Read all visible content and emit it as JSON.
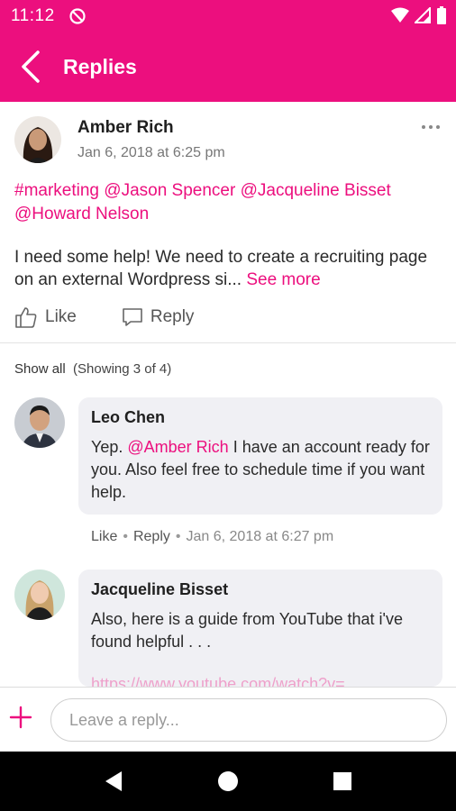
{
  "status_bar": {
    "time": "11:12"
  },
  "app_bar": {
    "title": "Replies"
  },
  "post": {
    "author": "Amber Rich",
    "timestamp": "Jan 6, 2018 at 6:25 pm",
    "tags": [
      "#marketing",
      "@Jason Spencer",
      "@Jacqueline Bisset",
      "@Howard Nelson"
    ],
    "body": "I need some help! We need to create a recruiting page on an external Wordpress si...",
    "see_more": "See more",
    "like_label": "Like",
    "reply_label": "Reply"
  },
  "replies_header": {
    "show_all": "Show all",
    "showing": "(Showing 3 of 4)"
  },
  "replies": [
    {
      "author": "Leo Chen",
      "text_before": "Yep. ",
      "mention": "@Amber Rich",
      "text_after": " I have an account ready for you.  Also feel free to schedule time if you want help.",
      "like": "Like",
      "reply": "Reply",
      "timestamp": "Jan 6, 2018 at 6:27 pm"
    },
    {
      "author": "Jacqueline Bisset",
      "text": "Also, here is a guide from YouTube that i've found helpful . . .",
      "link": "https://www.youtube.com/watch?v=..."
    }
  ],
  "composer": {
    "placeholder": "Leave a reply..."
  },
  "colors": {
    "accent": "#ec0f7e",
    "bubble": "#f0f0f4"
  }
}
